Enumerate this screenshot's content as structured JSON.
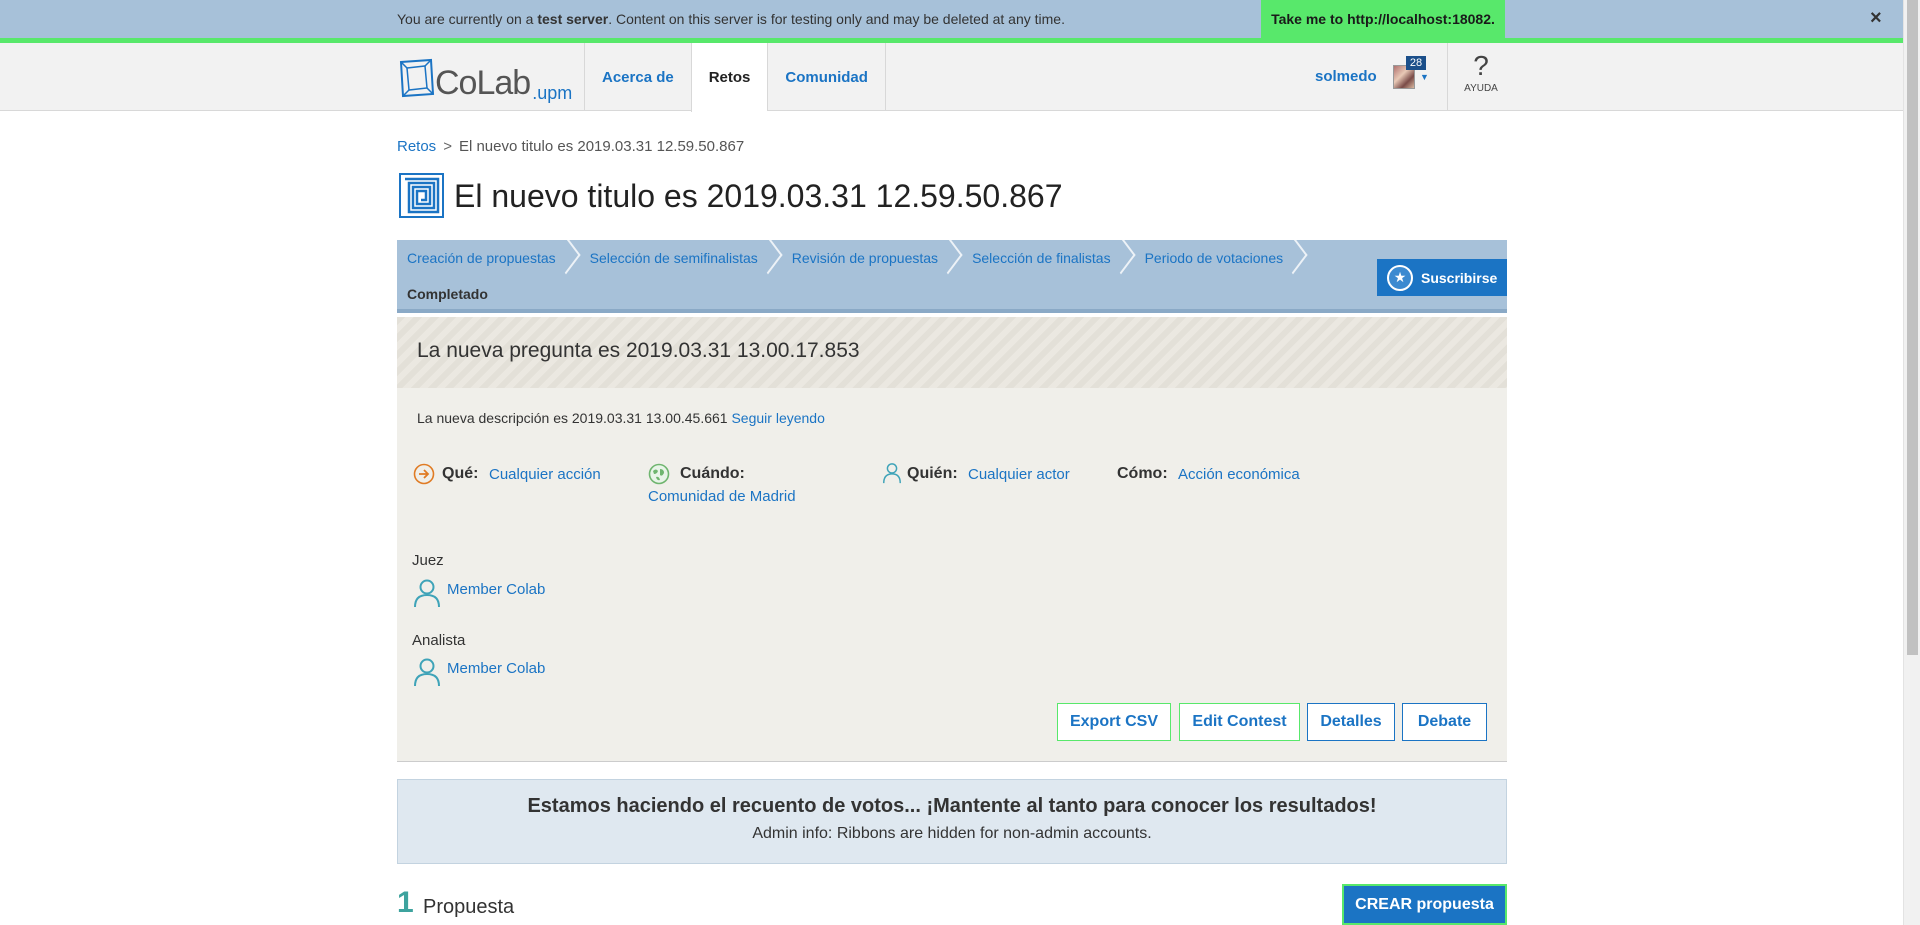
{
  "banner": {
    "prefix": "You are currently on a ",
    "server": "test server",
    "suffix": ". Content on this server is for testing only and may be deleted at any time.",
    "link": "Take me to http://localhost:18082.",
    "close": "×"
  },
  "header": {
    "logo_text": "CoLab",
    "logo_sub": ".upm",
    "nav": [
      {
        "label": "Acerca de"
      },
      {
        "label": "Retos"
      },
      {
        "label": "Comunidad"
      }
    ],
    "username": "solmedo",
    "notifications": "28",
    "help_icon": "?",
    "help_label": "AYUDA"
  },
  "breadcrumb": {
    "root": "Retos",
    "separator": ">",
    "current": "El nuevo titulo es 2019.03.31 12.59.50.867"
  },
  "contest": {
    "title": "El nuevo titulo es 2019.03.31 12.59.50.867",
    "phases": [
      {
        "label": "Creación de propuestas"
      },
      {
        "label": "Selección de semifinalistas"
      },
      {
        "label": "Revisión de propuestas"
      },
      {
        "label": "Selección de finalistas"
      },
      {
        "label": "Periodo de votaciones"
      }
    ],
    "current_phase": "Completado",
    "subscribe_label": "Suscribirse",
    "question": "La nueva pregunta es 2019.03.31 13.00.17.853",
    "description": "La nueva descripción es 2019.03.31 13.00.45.661",
    "read_more": "Seguir leyendo",
    "meta": {
      "que_label": "Qué:",
      "que_value": "Cualquier acción",
      "cuando_label": "Cuándo:",
      "cuando_value": "Comunidad de Madrid",
      "quien_label": "Quién:",
      "quien_value": "Cualquier actor",
      "como_label": "Cómo:",
      "como_value": "Acción económica"
    },
    "roles": [
      {
        "title": "Juez",
        "member": "Member Colab"
      },
      {
        "title": "Analista",
        "member": "Member Colab"
      }
    ],
    "buttons": {
      "export": "Export CSV",
      "edit": "Edit Contest",
      "details": "Detalles",
      "debate": "Debate"
    }
  },
  "counting": {
    "title": "Estamos haciendo el recuento de votos... ¡Mantente al tanto para conocer los resultados!",
    "admin_info": "Admin info: Ribbons are hidden for non-admin accounts."
  },
  "proposals": {
    "count": "1",
    "label": "Propuesta",
    "create_label": "CREAR propuesta"
  },
  "colors": {
    "accent_blue": "#1b74c4",
    "banner_blue": "#a7c1d9",
    "test_green": "#58e86b",
    "count_teal": "#3ea39e"
  },
  "icons": [
    "logo-icon",
    "close-icon",
    "help-icon",
    "maze-icon",
    "star-icon",
    "arrow-right-icon",
    "globe-icon",
    "person-icon",
    "caret-down-icon"
  ]
}
